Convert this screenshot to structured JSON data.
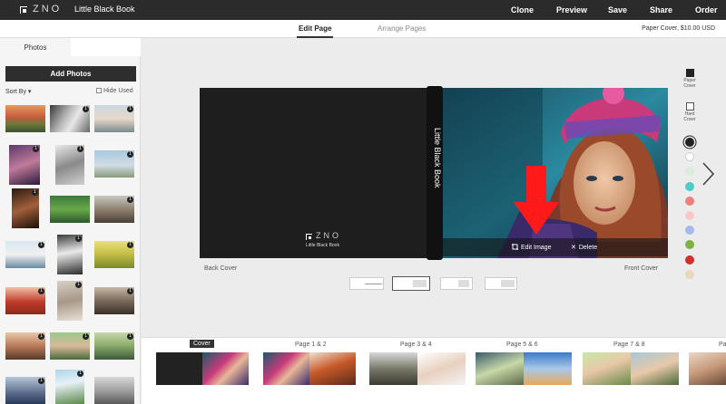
{
  "topbar": {
    "logo": "ZNO",
    "title": "Little Black Book",
    "nav": [
      "Clone",
      "Preview",
      "Save",
      "Share",
      "Order"
    ]
  },
  "subbar": {
    "tabs": [
      "Edit Page",
      "Arrange Pages"
    ],
    "price": "Paper Cover, $10.00 USD"
  },
  "sidebar": {
    "tab": "Photos",
    "add_photos": "Add Photos",
    "sort_by": "Sort By ▾",
    "hide_used": "Hide Used",
    "badge": "1"
  },
  "book": {
    "spine_title": "Little Black Book",
    "back_logo": "ZNO",
    "back_title": "Little Black Book",
    "edit_image": "Edit Image",
    "delete": "Delete",
    "back_cover": "Back Cover",
    "front_cover": "Front Cover"
  },
  "cover_options": {
    "paper": "Paper Cover",
    "hard": "Hard Cover"
  },
  "colors": [
    "#222222",
    "#ffffff",
    "#d8ecd8",
    "#4ecdc4",
    "#f08080",
    "#f9c8c8",
    "#a8b8e8",
    "#7cb342",
    "#d32f2f",
    "#e8d8c0"
  ],
  "strip": {
    "cover": "Cover",
    "pages": [
      "Page 1 & 2",
      "Page 3 & 4",
      "Page 5 & 6",
      "Page 7 & 8",
      "Pa"
    ]
  }
}
